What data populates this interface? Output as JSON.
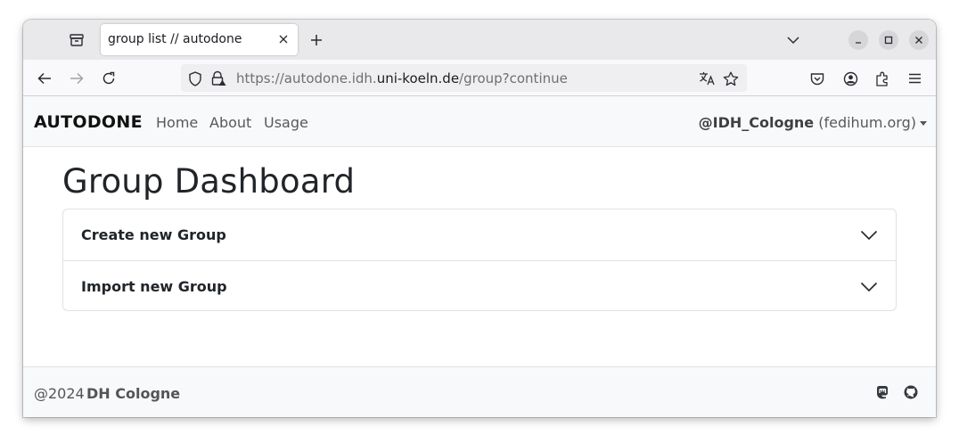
{
  "browser": {
    "tab": {
      "title": "group list // autodone"
    },
    "url": {
      "prefix": "https://autodone.idh.",
      "domain": "uni-koeln.de",
      "path": "/group?continue"
    }
  },
  "site": {
    "brand": "AUTODONE",
    "nav": [
      "Home",
      "About",
      "Usage"
    ],
    "user": {
      "handle": "@IDH_Cologne",
      "instance": "(fedihum.org)"
    }
  },
  "main": {
    "title": "Group Dashboard",
    "accordion": [
      "Create new Group",
      "Import new Group"
    ]
  },
  "footer": {
    "year": "@2024",
    "org": "DH Cologne"
  }
}
